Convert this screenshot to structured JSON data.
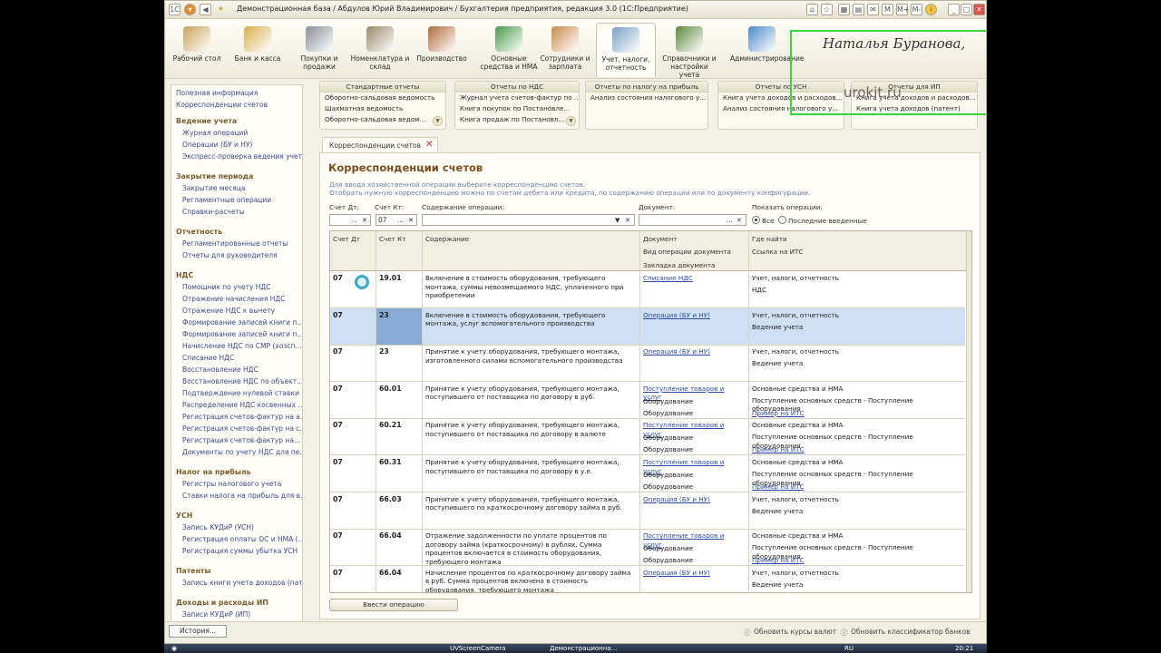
{
  "window": {
    "title": "Демонстрационная база / Абдулов Юрий Владимирович / Бухгалтерия предприятия, редакция 3.0  (1С:Предприятие)"
  },
  "sections": [
    {
      "label": "Рабочий стол",
      "color": "#c9a25a"
    },
    {
      "label": "Банк и касса",
      "color": "#d9b04a"
    },
    {
      "label": "Покупки и продажи",
      "color": "#8a8f98"
    },
    {
      "label": "Номенклатура и склад",
      "color": "#9a8a6a"
    },
    {
      "label": "Производство",
      "color": "#b06a3a"
    },
    {
      "label": "Основные средства и НМА",
      "color": "#4a9a4a"
    },
    {
      "label": "Сотрудники и зарплата",
      "color": "#c98a4a"
    },
    {
      "label": "Учет, налоги, отчетность",
      "color": "#7aa0c8"
    },
    {
      "label": "Справочники и настройки учета",
      "color": "#5a8a3a"
    },
    {
      "label": "Администрирование",
      "color": "#4a8ac8"
    }
  ],
  "watermark": {
    "name": "Наталья Буранова,",
    "site": "urokit.ru"
  },
  "sidebar": {
    "top": [
      "Полезная информация",
      "Корреспонденции счетов"
    ],
    "groups": [
      {
        "title": "Ведение учета",
        "items": [
          "Журнал операций",
          "Операции (БУ и НУ)",
          "Экспресс-проверка ведения учета"
        ]
      },
      {
        "title": "Закрытие периода",
        "items": [
          "Закрытие месяца",
          "Регламентные операции",
          "Справки-расчеты"
        ]
      },
      {
        "title": "Отчетность",
        "items": [
          "Регламентированные отчеты",
          "Отчеты для руководителя"
        ]
      },
      {
        "title": "НДС",
        "items": [
          "Помощник по учету НДС",
          "Отражение начисления НДС",
          "Отражение НДС к вычету",
          "Формирование записей книги п...",
          "Формирование записей книги п...",
          "Начисление НДС по СМР (хозсп...",
          "Списание НДС",
          "Восстановление НДС",
          "Восстановление НДС по объект...",
          "Подтверждение нулевой ставки ...",
          "Распределение НДС косвенных ...",
          "Регистрация счетов-фактур на а...",
          "Регистрация счетов-фактур на с...",
          "Регистрация счетов-фактур на...",
          "Документы по учету НДС для пе..."
        ]
      },
      {
        "title": "Налог на прибыль",
        "items": [
          "Регистры налогового учета",
          "Ставки налога на прибыль для в..."
        ]
      },
      {
        "title": "УСН",
        "items": [
          "Запись КУДиР (УСН)",
          "Регистрация оплаты ОС и НМА (...",
          "Регистрация суммы убытка УСН"
        ]
      },
      {
        "title": "Патенты",
        "items": [
          "Запись книги учета доходов (пат..."
        ]
      },
      {
        "title": "Доходы и расходы ИП",
        "items": [
          "Записи КУДиР (ИП)"
        ]
      }
    ]
  },
  "panels": [
    {
      "title": "Стандартные отчеты",
      "items": [
        "Оборотно-сальдовая ведомость",
        "Шахматная ведомость",
        "Оборотно-сальдовая ведом..."
      ]
    },
    {
      "title": "Отчеты по НДС",
      "items": [
        "Журнал учета счетов-фактур по ...",
        "Книга покупок по Постановле...",
        "Книга продаж по Постановл..."
      ]
    },
    {
      "title": "Отчеты по налогу на прибыль",
      "items": [
        "Анализ состояния налогового у..."
      ]
    },
    {
      "title": "Отчеты по УСН",
      "items": [
        "Книга учета доходов и расходов...",
        "Анализ состояния налогового у..."
      ]
    },
    {
      "title": "Отчеты для ИП",
      "items": [
        "Книга учета доходов и расходов...",
        "Книга учета доходов (патент)"
      ]
    }
  ],
  "form": {
    "tab_label": "Корреспонденции счетов",
    "title": "Корреспонденции счетов",
    "hint1": "Для ввода хозяйственной операции выберите корреспонденцию счетов.",
    "hint2": "Отобрать нужную корреспонденцию можно по счетам дебета или кредита, по содержанию операции или по документу конфигурации.",
    "filters": {
      "dt_label": "Счет Дт:",
      "dt_value": "",
      "kt_label": "Счет Кт:",
      "kt_value": "07",
      "content_label": "Содержание операции:",
      "content_value": "",
      "doc_label": "Документ:",
      "doc_value": "",
      "show_label": "Показать операции:",
      "opt_all": "Все",
      "opt_last": "Последние введенные"
    },
    "columns": {
      "dt": "Счет Дт",
      "kt": "Счет Кт",
      "content": "Содержание",
      "doc": "Документ",
      "doc2": "Вид операции документа",
      "doc3": "Закладка документа",
      "where": "Где найти",
      "where2": "Ссылка на ИТС"
    },
    "rows": [
      {
        "dt": "07",
        "kt": "19.01",
        "content": "Включение в стоимость оборудования, требующего монтажа, суммы невозмещаемого НДС, уплаченного при приобретении",
        "doc": "Списание НДС",
        "doc2": "",
        "doc3": "",
        "where": "Учет, налоги, отчетность",
        "where2": "НДС",
        "where3": ""
      },
      {
        "dt": "07",
        "kt": "23",
        "content": "Включение в стоимость оборудования, требующего монтажа, услуг вспомогательного производства",
        "doc": "Операция (БУ и НУ)",
        "doc2": "",
        "doc3": "",
        "where": "Учет, налоги, отчетность",
        "where2": "Ведение учета",
        "where3": ""
      },
      {
        "dt": "07",
        "kt": "23",
        "content": "Принятие к учету оборудования, требующего монтажа, изготовленного силами вспомогательного производства",
        "doc": "Операция (БУ и НУ)",
        "doc2": "",
        "doc3": "",
        "where": "Учет, налоги, отчетность",
        "where2": "Ведение учета",
        "where3": ""
      },
      {
        "dt": "07",
        "kt": "60.01",
        "content": "Принятие к учету оборудования, требующего монтажа, поступившего от поставщика по договору в руб.",
        "doc": "Поступление товаров и услуг",
        "doc2": "Оборудование",
        "doc3": "Оборудование",
        "where": "Основные средства и НМА",
        "where2": "Поступление основных средств - Поступление оборудования",
        "where3": "Пример на ИТС"
      },
      {
        "dt": "07",
        "kt": "60.21",
        "content": "Принятие к учету оборудования, требующего монтажа, поступившего от поставщика по договору в валюте",
        "doc": "Поступление товаров и услуг",
        "doc2": "Оборудование",
        "doc3": "Оборудование",
        "where": "Основные средства и НМА",
        "where2": "Поступление основных средств - Поступление оборудования",
        "where3": "Пример на ИТС"
      },
      {
        "dt": "07",
        "kt": "60.31",
        "content": "Принятие к учету оборудования, требующего монтажа, поступившего от поставщика по договору в у.е.",
        "doc": "Поступление товаров и услуг",
        "doc2": "Оборудование",
        "doc3": "Оборудование",
        "where": "Основные средства и НМА",
        "where2": "Поступление основных средств - Поступление оборудования",
        "where3": "Пример на ИТС"
      },
      {
        "dt": "07",
        "kt": "66.03",
        "content": "Принятие к учету оборудования, требующего монтажа, поступившего по краткосрочному договору займа в руб.",
        "doc": "Операция (БУ и НУ)",
        "doc2": "",
        "doc3": "",
        "where": "Учет, налоги, отчетность",
        "where2": "Ведение учета",
        "where3": ""
      },
      {
        "dt": "07",
        "kt": "66.04",
        "content": "Отражение задолженности по уплате процентов по договору займа (краткосрочному) в рублях. Сумма процентов включается в стоимость оборудования, требующего монтажа",
        "doc": "Поступление товаров и услуг",
        "doc2": "Оборудование",
        "doc3": "Оборудование",
        "where": "Основные средства и НМА",
        "where2": "Поступление основных средств - Поступление оборудования",
        "where3": "Пример на ИТС"
      },
      {
        "dt": "07",
        "kt": "66.04",
        "content": "Начисление процентов по краткосрочному договору займа в руб. Сумма процентов включена в стоимость оборудования, требующего монтажа",
        "doc": "Операция (БУ и НУ)",
        "doc2": "",
        "doc3": "",
        "where": "Учет, налоги, отчетность",
        "where2": "Ведение учета",
        "where3": ""
      }
    ],
    "intro_button": "Ввести операцию"
  },
  "statusbar": {
    "history": "История...",
    "rates": "Обновить курсы валют",
    "classifier": "Обновить классификатор банков"
  },
  "taskbar": {
    "item1": "UVScreenCamera",
    "item2": "Демонстрационна...",
    "lang": "RU",
    "clock": "20:21"
  }
}
